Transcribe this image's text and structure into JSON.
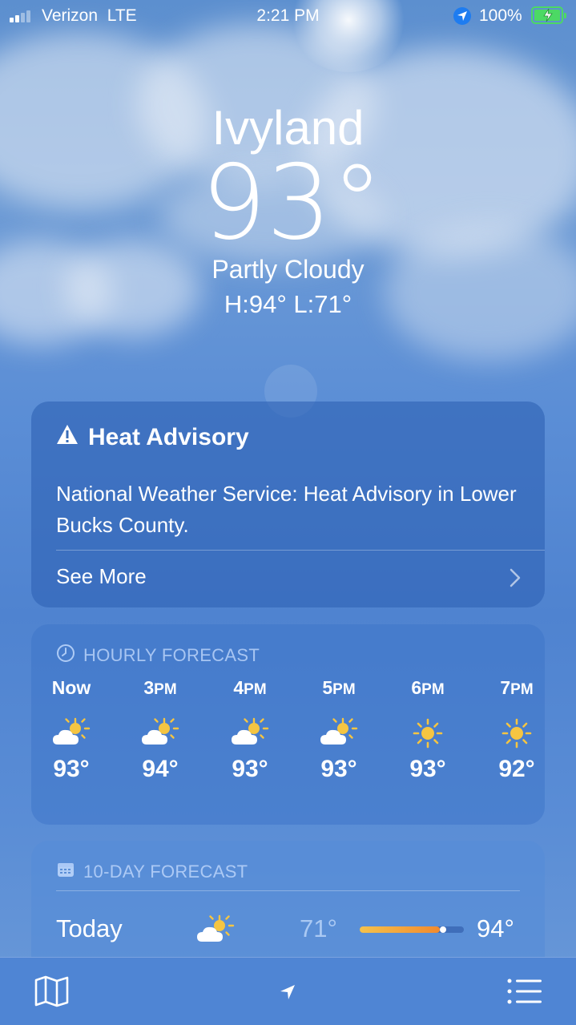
{
  "status_bar": {
    "carrier": "Verizon",
    "network": "LTE",
    "time": "2:21 PM",
    "battery_percent": "100%",
    "signal_bars_on": 2,
    "signal_bars_total": 4
  },
  "header": {
    "city": "Ivyland",
    "temperature": "93°",
    "condition": "Partly Cloudy",
    "high_low": "H:94°  L:71°"
  },
  "advisory": {
    "title": "Heat Advisory",
    "body": "National Weather Service: Heat Advisory in Lower Bucks County.",
    "see_more": "See More",
    "icon": "warning-triangle-icon"
  },
  "hourly": {
    "heading": "HOURLY FORECAST",
    "icon": "clock-icon",
    "items": [
      {
        "time": "Now",
        "icon": "partly-cloudy-icon",
        "temp": "93°"
      },
      {
        "time": "3PM",
        "icon": "partly-cloudy-icon",
        "temp": "94°"
      },
      {
        "time": "4PM",
        "icon": "partly-cloudy-icon",
        "temp": "93°"
      },
      {
        "time": "5PM",
        "icon": "partly-cloudy-icon",
        "temp": "93°"
      },
      {
        "time": "6PM",
        "icon": "sun-icon",
        "temp": "93°"
      },
      {
        "time": "7PM",
        "icon": "sun-icon",
        "temp": "92°"
      }
    ]
  },
  "ten_day": {
    "heading": "10-DAY FORECAST",
    "icon": "calendar-icon",
    "rows": [
      {
        "day": "Today",
        "icon": "partly-cloudy-icon",
        "low": "71°",
        "high": "94°",
        "range_fill": 0.77
      }
    ]
  },
  "toolbar": {
    "map_icon": "map-icon",
    "location_icon": "location-arrow-icon",
    "list_icon": "list-icon"
  },
  "colors": {
    "battery": "#4cd964",
    "range_start": "#f5c24c",
    "range_end": "#f28a2e",
    "location_badge": "#1e7cf0"
  }
}
